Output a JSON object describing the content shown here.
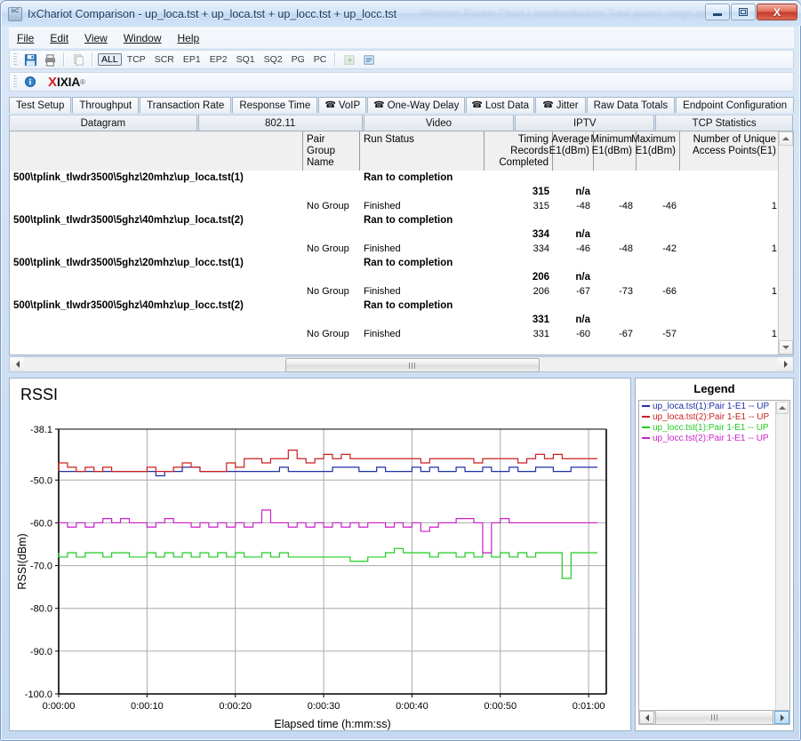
{
  "window": {
    "title": "IxChariot Comparison - up_loca.tst + up_loca.tst + up_locc.tst + up_locc.tst",
    "app_icon_label": "IxC",
    "ghost_text": "Wireless Router Chart  |  smallnetbuilder  Total power range performance",
    "minimize_label": "Minimize",
    "maximize_label": "Maximize",
    "close_label": "X"
  },
  "menubar": {
    "items": [
      {
        "label": "File",
        "accel": "F"
      },
      {
        "label": "Edit",
        "accel": "E"
      },
      {
        "label": "View",
        "accel": "V"
      },
      {
        "label": "Window",
        "accel": "W"
      },
      {
        "label": "Help",
        "accel": "H"
      }
    ]
  },
  "toolbar": {
    "filters": [
      "ALL",
      "TCP",
      "SCR",
      "EP1",
      "EP2",
      "SQ1",
      "SQ2",
      "PG",
      "PC"
    ],
    "active_filter": "ALL",
    "icons": [
      "save-icon",
      "print-icon",
      "copy-icon",
      "export-icon",
      "report-icon"
    ],
    "brand": {
      "x": "X",
      "name": "IXIA",
      "tm": "®",
      "info": "i"
    }
  },
  "tabs": {
    "row1": [
      {
        "label": "Test Setup",
        "icon": ""
      },
      {
        "label": "Throughput",
        "icon": ""
      },
      {
        "label": "Transaction Rate",
        "icon": ""
      },
      {
        "label": "Response Time",
        "icon": ""
      },
      {
        "label": "VoIP",
        "icon": "phone-icon"
      },
      {
        "label": "One-Way Delay",
        "icon": "phone-icon"
      },
      {
        "label": "Lost Data",
        "icon": "phone-icon"
      },
      {
        "label": "Jitter",
        "icon": "phone-icon"
      },
      {
        "label": "Raw Data Totals",
        "icon": ""
      },
      {
        "label": "Endpoint Configuration",
        "icon": ""
      }
    ],
    "row2": [
      {
        "label": "Datagram"
      },
      {
        "label": "802.11"
      },
      {
        "label": "Video"
      },
      {
        "label": "IPTV"
      },
      {
        "label": "TCP Statistics"
      }
    ],
    "selected_row2": "802.11"
  },
  "table": {
    "columns": [
      {
        "label": "",
        "align": "left"
      },
      {
        "label": "Pair Group\nName",
        "align": "left"
      },
      {
        "label": "Run Status",
        "align": "left"
      },
      {
        "label": "Timing Records\nCompleted",
        "align": "right"
      },
      {
        "label": "Average\nE1(dBm)",
        "align": "right"
      },
      {
        "label": "Minimum\nE1(dBm)",
        "align": "right"
      },
      {
        "label": "Maximum\nE1(dBm)",
        "align": "right"
      },
      {
        "label": "Number of Unique\nAccess Points(E1)",
        "align": "right"
      }
    ],
    "column_headers_line1": [
      "",
      "Pair Group",
      "Run Status",
      "Timing Records",
      "Average",
      "Minimum",
      "Maximum",
      "Number of Unique"
    ],
    "column_headers_line2": [
      "",
      "Name",
      "",
      "Completed",
      "E1(dBm)",
      "E1(dBm)",
      "E1(dBm)",
      "Access Points(E1)"
    ],
    "groups": [
      {
        "name": "500\\tplink_tlwdr3500\\5ghz\\20mhz\\up_loca.tst(1)",
        "status": "Ran to completion",
        "summary": {
          "timing_records": "315",
          "average": "n/a",
          "minimum": "",
          "maximum": "",
          "aps": ""
        },
        "pair": {
          "group_name": "No Group",
          "status": "Finished",
          "timing_records": "315",
          "average": "-48",
          "minimum": "-48",
          "maximum": "-46",
          "aps": "1"
        }
      },
      {
        "name": "500\\tplink_tlwdr3500\\5ghz\\40mhz\\up_loca.tst(2)",
        "status": "Ran to completion",
        "summary": {
          "timing_records": "334",
          "average": "n/a",
          "minimum": "",
          "maximum": "",
          "aps": ""
        },
        "pair": {
          "group_name": "No Group",
          "status": "Finished",
          "timing_records": "334",
          "average": "-46",
          "minimum": "-48",
          "maximum": "-42",
          "aps": "1"
        }
      },
      {
        "name": "500\\tplink_tlwdr3500\\5ghz\\20mhz\\up_locc.tst(1)",
        "status": "Ran to completion",
        "summary": {
          "timing_records": "206",
          "average": "n/a",
          "minimum": "",
          "maximum": "",
          "aps": ""
        },
        "pair": {
          "group_name": "No Group",
          "status": "Finished",
          "timing_records": "206",
          "average": "-67",
          "minimum": "-73",
          "maximum": "-66",
          "aps": "1"
        }
      },
      {
        "name": "500\\tplink_tlwdr3500\\5ghz\\40mhz\\up_locc.tst(2)",
        "status": "Ran to completion",
        "summary": {
          "timing_records": "331",
          "average": "n/a",
          "minimum": "",
          "maximum": "",
          "aps": ""
        },
        "pair": {
          "group_name": "No Group",
          "status": "Finished",
          "timing_records": "331",
          "average": "-60",
          "minimum": "-67",
          "maximum": "-57",
          "aps": "1"
        }
      }
    ]
  },
  "legend": {
    "title": "Legend",
    "entries": [
      {
        "label": "up_loca.tst(1):Pair 1-E1 -- UP",
        "color": "#1f2fa8"
      },
      {
        "label": "up_loca.tst(2):Pair 1-E1 -- UP",
        "color": "#cc1f1f"
      },
      {
        "label": "up_locc.tst(1):Pair 1-E1 -- UP",
        "color": "#1fcc1f"
      },
      {
        "label": "up_locc.tst(2):Pair 1-E1 -- UP",
        "color": "#cc1fcc"
      }
    ]
  },
  "chart_data": {
    "type": "line",
    "title": "RSSI",
    "xlabel": "Elapsed time (h:mm:ss)",
    "ylabel": "RSSI(dBm)",
    "ylim": [
      -100.0,
      -38.1
    ],
    "yticks": [
      -38.1,
      -50.0,
      -60.0,
      -70.0,
      -80.0,
      -90.0,
      -100.0
    ],
    "ytick_labels": [
      "-38.1",
      "-50.0",
      "-60.0",
      "-70.0",
      "-80.0",
      "-90.0",
      "-100.0"
    ],
    "xlim": [
      0,
      62
    ],
    "xticks": [
      0,
      10,
      20,
      30,
      40,
      50,
      60
    ],
    "xtick_labels": [
      "0:00:00",
      "0:00:10",
      "0:00:20",
      "0:00:30",
      "0:00:40",
      "0:00:50",
      "0:01:00"
    ],
    "grid": true,
    "legend_position": "right-panel",
    "series": [
      {
        "name": "up_loca.tst(1):Pair 1-E1 -- UP",
        "color": "#1f2fa8",
        "x": [
          0,
          1,
          2,
          3,
          4,
          5,
          6,
          7,
          8,
          9,
          10,
          11,
          12,
          13,
          14,
          15,
          16,
          17,
          18,
          19,
          20,
          21,
          22,
          23,
          24,
          25,
          26,
          27,
          28,
          29,
          30,
          31,
          32,
          33,
          34,
          35,
          36,
          37,
          38,
          39,
          40,
          41,
          42,
          43,
          44,
          45,
          46,
          47,
          48,
          49,
          50,
          51,
          52,
          53,
          54,
          55,
          56,
          57,
          58,
          59,
          60,
          61
        ],
        "values": [
          -48,
          -48,
          -48,
          -48,
          -48,
          -48,
          -48,
          -48,
          -48,
          -48,
          -48,
          -48,
          -49,
          -48,
          -48,
          -47,
          -47,
          -48,
          -48,
          -48,
          -48,
          -48,
          -48,
          -48,
          -48,
          -48,
          -47,
          -48,
          -48,
          -48,
          -48,
          -48,
          -47,
          -47,
          -47,
          -48,
          -48,
          -47,
          -48,
          -48,
          -48,
          -47,
          -48,
          -47,
          -48,
          -48,
          -47,
          -48,
          -48,
          -47,
          -48,
          -48,
          -47,
          -48,
          -48,
          -47,
          -47,
          -48,
          -48,
          -47,
          -47,
          -47
        ]
      },
      {
        "name": "up_loca.tst(2):Pair 1-E1 -- UP",
        "color": "#cc1f1f",
        "x": [
          0,
          1,
          2,
          3,
          4,
          5,
          6,
          7,
          8,
          9,
          10,
          11,
          12,
          13,
          14,
          15,
          16,
          17,
          18,
          19,
          20,
          21,
          22,
          23,
          24,
          25,
          26,
          27,
          28,
          29,
          30,
          31,
          32,
          33,
          34,
          35,
          36,
          37,
          38,
          39,
          40,
          41,
          42,
          43,
          44,
          45,
          46,
          47,
          48,
          49,
          50,
          51,
          52,
          53,
          54,
          55,
          56,
          57,
          58,
          59,
          60,
          61
        ],
        "values": [
          -48,
          -46,
          -47,
          -48,
          -47,
          -48,
          -47,
          -48,
          -48,
          -48,
          -48,
          -47,
          -48,
          -48,
          -47,
          -46,
          -47,
          -48,
          -48,
          -48,
          -46,
          -47,
          -45,
          -45,
          -46,
          -45,
          -45,
          -43,
          -45,
          -46,
          -45,
          -44,
          -45,
          -44,
          -45,
          -45,
          -45,
          -45,
          -45,
          -45,
          -45,
          -45,
          -46,
          -45,
          -45,
          -45,
          -45,
          -45,
          -46,
          -45,
          -45,
          -45,
          -45,
          -46,
          -45,
          -44,
          -45,
          -44,
          -45,
          -45,
          -45,
          -45
        ]
      },
      {
        "name": "up_locc.tst(1):Pair 1-E1 -- UP",
        "color": "#1fcc1f",
        "x": [
          0,
          1,
          2,
          3,
          4,
          5,
          6,
          7,
          8,
          9,
          10,
          11,
          12,
          13,
          14,
          15,
          16,
          17,
          18,
          19,
          20,
          21,
          22,
          23,
          24,
          25,
          26,
          27,
          28,
          29,
          30,
          31,
          32,
          33,
          34,
          35,
          36,
          37,
          38,
          39,
          40,
          41,
          42,
          43,
          44,
          45,
          46,
          47,
          48,
          49,
          50,
          51,
          52,
          53,
          54,
          55,
          56,
          57,
          58,
          59,
          60,
          61
        ],
        "values": [
          -67,
          -68,
          -67,
          -68,
          -67,
          -67,
          -68,
          -67,
          -67,
          -68,
          -68,
          -67,
          -68,
          -67,
          -68,
          -67,
          -68,
          -67,
          -68,
          -67,
          -68,
          -67,
          -68,
          -68,
          -67,
          -68,
          -67,
          -68,
          -68,
          -68,
          -68,
          -68,
          -68,
          -68,
          -69,
          -69,
          -68,
          -68,
          -67,
          -66,
          -67,
          -67,
          -67,
          -68,
          -67,
          -67,
          -68,
          -67,
          -68,
          -67,
          -68,
          -67,
          -68,
          -67,
          -68,
          -67,
          -67,
          -67,
          -73,
          -67,
          -67,
          -67
        ]
      },
      {
        "name": "up_locc.tst(2):Pair 1-E1 -- UP",
        "color": "#cc1fcc",
        "x": [
          0,
          1,
          2,
          3,
          4,
          5,
          6,
          7,
          8,
          9,
          10,
          11,
          12,
          13,
          14,
          15,
          16,
          17,
          18,
          19,
          20,
          21,
          22,
          23,
          24,
          25,
          26,
          27,
          28,
          29,
          30,
          31,
          32,
          33,
          34,
          35,
          36,
          37,
          38,
          39,
          40,
          41,
          42,
          43,
          44,
          45,
          46,
          47,
          48,
          49,
          50,
          51,
          52,
          53,
          54,
          55,
          56,
          57,
          58,
          59,
          60,
          61
        ],
        "values": [
          -60,
          -60,
          -61,
          -60,
          -61,
          -60,
          -59,
          -60,
          -59,
          -60,
          -60,
          -61,
          -60,
          -59,
          -60,
          -60,
          -61,
          -60,
          -61,
          -60,
          -61,
          -60,
          -61,
          -60,
          -57,
          -60,
          -60,
          -61,
          -60,
          -61,
          -60,
          -61,
          -60,
          -61,
          -60,
          -61,
          -60,
          -60,
          -61,
          -60,
          -61,
          -60,
          -62,
          -61,
          -60,
          -60,
          -59,
          -59,
          -60,
          -67,
          -60,
          -59,
          -60,
          -60,
          -60,
          -60,
          -60,
          -60,
          -60,
          -60,
          -60,
          -60
        ]
      }
    ]
  },
  "scrollbars": {
    "table_h": {
      "left_arrow": "left-arrow",
      "right_arrow": "right-arrow",
      "thumb": "thumb"
    },
    "table_v": {
      "up_arrow": "up-arrow",
      "down_arrow": "down-arrow"
    },
    "legend_h": {
      "left_arrow": "left-arrow",
      "right_arrow": "right-arrow"
    }
  }
}
